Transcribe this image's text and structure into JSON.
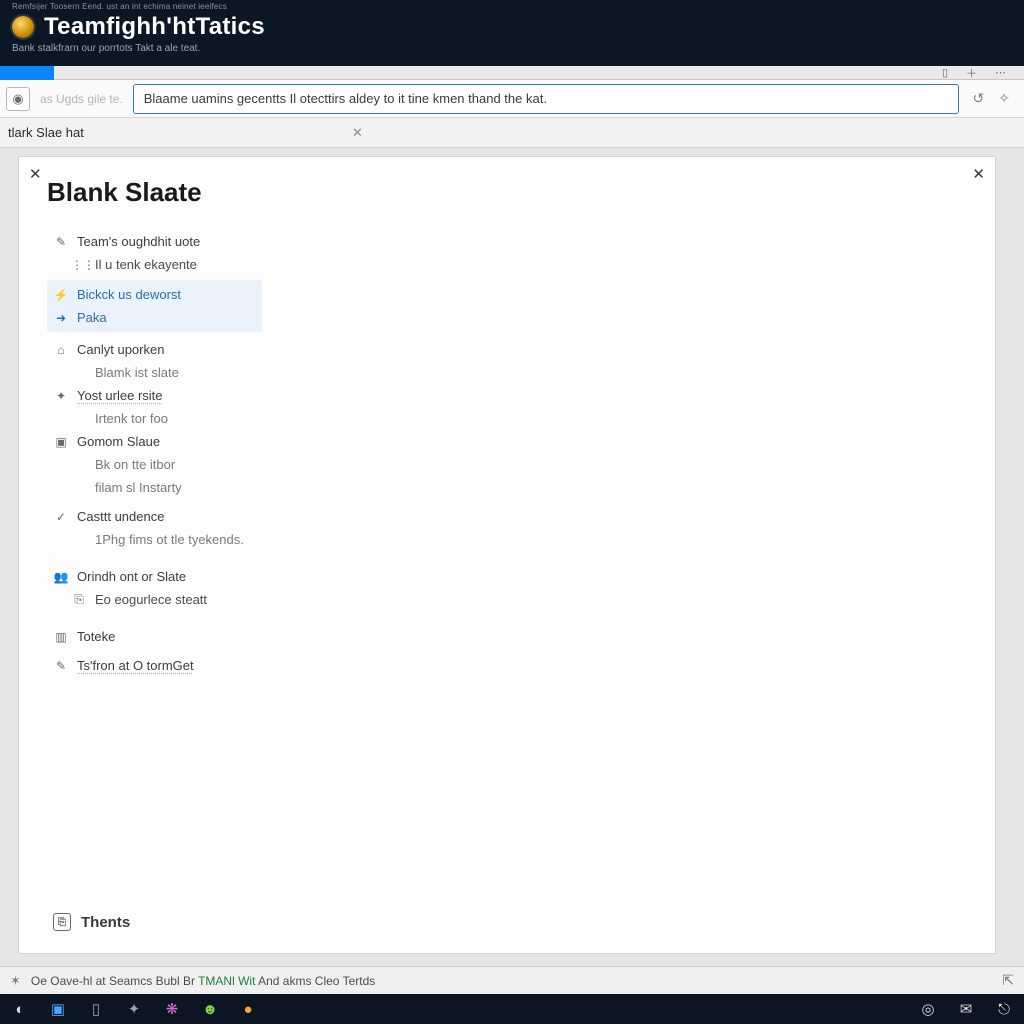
{
  "titlebar": {
    "tiny_menu": "Remfsijer Toosern  Eend. ust an int echima neinet  ieeifecs",
    "app_title": "Teamfighh'htTatics",
    "subtitle": "Bank stalkfrarn our porrtots Takt a ale teat."
  },
  "urlrow": {
    "hint": "as Ugds gile te.",
    "url_value": "Blaame uamins gecentts Il otecttirs aldey to it tine kmen thand the kat."
  },
  "tabbar": {
    "tab_label": "tlark Slae hat"
  },
  "panel": {
    "title": "Blank Slaate",
    "thents": "Thents"
  },
  "nav": {
    "items": [
      {
        "icon": "✎",
        "label": "Team's oughdhit uote",
        "type": "heading"
      },
      {
        "icon": "⋮⋮",
        "label": "Il u tenk ekayente",
        "type": "sub"
      },
      {
        "icon": "⚡",
        "label": "Bickck us deworst",
        "type": "sel"
      },
      {
        "icon": "➜",
        "label": "Paka",
        "type": "sel"
      },
      {
        "icon": "⌂",
        "label": "Canlyt uporken",
        "type": "heading"
      },
      {
        "icon": "",
        "label": "Blamk ist slate",
        "type": "sub muted"
      },
      {
        "icon": "✦",
        "label": "Yost urlee rsite",
        "type": "heading dotted"
      },
      {
        "icon": "",
        "label": "Irtenk tor foo",
        "type": "sub muted"
      },
      {
        "icon": "▣",
        "label": "Gomom Slaue",
        "type": "heading"
      },
      {
        "icon": "",
        "label": "Bk on tte itbor",
        "type": "sub muted"
      },
      {
        "icon": "",
        "label": "filam sl Instarty",
        "type": "sub muted"
      },
      {
        "icon": "✓",
        "label": "Casttt undence",
        "type": "heading"
      },
      {
        "icon": "",
        "label": "1Phg fims ot tle tyekends.",
        "type": "sub muted"
      },
      {
        "icon": "👥",
        "label": "Orindh ont or Slate",
        "type": "heading"
      },
      {
        "icon": "⎘",
        "label": "Eo eogurlece steatt",
        "type": "sub"
      },
      {
        "icon": "▥",
        "label": "Toteke",
        "type": "heading"
      },
      {
        "icon": "✎",
        "label": "Ts'fron at O tormGet",
        "type": "heading dotted"
      }
    ]
  },
  "statusbar": {
    "text_a": "Oe Oave-hl at Seamcs Bubl Br ",
    "link": "TMANl Wit",
    "text_b": " And akms Cleo Tertds"
  }
}
